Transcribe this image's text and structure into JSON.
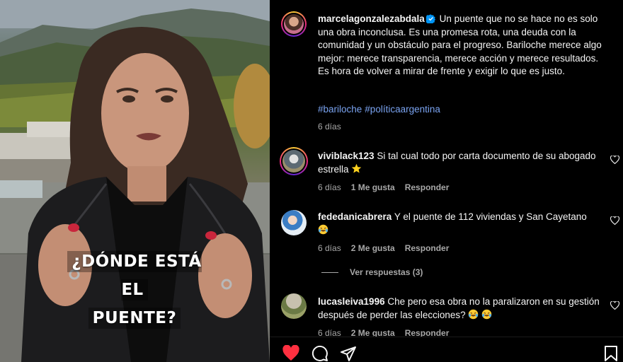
{
  "video": {
    "overlay_line1": "¿DÓNDE ESTÁ EL",
    "overlay_line2": "PUENTE?"
  },
  "post": {
    "author": "marcelagonzalezabdala",
    "verified": true,
    "caption": "Un puente que no se hace no es solo una obra inconclusa. Es una promesa rota, una deuda con la comunidad y un obstáculo para el progreso. Bariloche merece algo mejor: merece transparencia, merece acción y merece resultados. Es hora de volver a mirar de frente y exigir lo que es justo.",
    "hashtags": [
      "#bariloche",
      "#políticaargentina"
    ],
    "time": "6 días"
  },
  "comments": [
    {
      "user": "viviblack123",
      "text": "Si tal cual todo por carta documento de su abogado estrella",
      "emoji": "star",
      "time": "6 días",
      "likes": "1 Me gusta",
      "reply": "Responder"
    },
    {
      "user": "fededanicabrera",
      "text": "Y el puente de 112 viviendas y San Cayetano",
      "emoji": "laugh-cry",
      "time": "6 días",
      "likes": "2 Me gusta",
      "reply": "Responder",
      "view_replies": "Ver respuestas (3)"
    },
    {
      "user": "lucasleiva1996",
      "text": "Che pero esa obra no la paralizaron en su gestión después de perder las elecciones?",
      "emoji": "laugh-cry",
      "time": "6 días",
      "likes": "2 Me gusta",
      "reply": "Responder"
    }
  ],
  "icons": {
    "like": "heart-filled-icon",
    "comment": "comment-icon",
    "share": "send-icon",
    "save": "bookmark-icon"
  },
  "colors": {
    "like_red": "#ff3040",
    "hashtag_blue": "#7aa3f0",
    "verified_blue": "#0095f6",
    "muted_text": "#a8a8a8"
  }
}
